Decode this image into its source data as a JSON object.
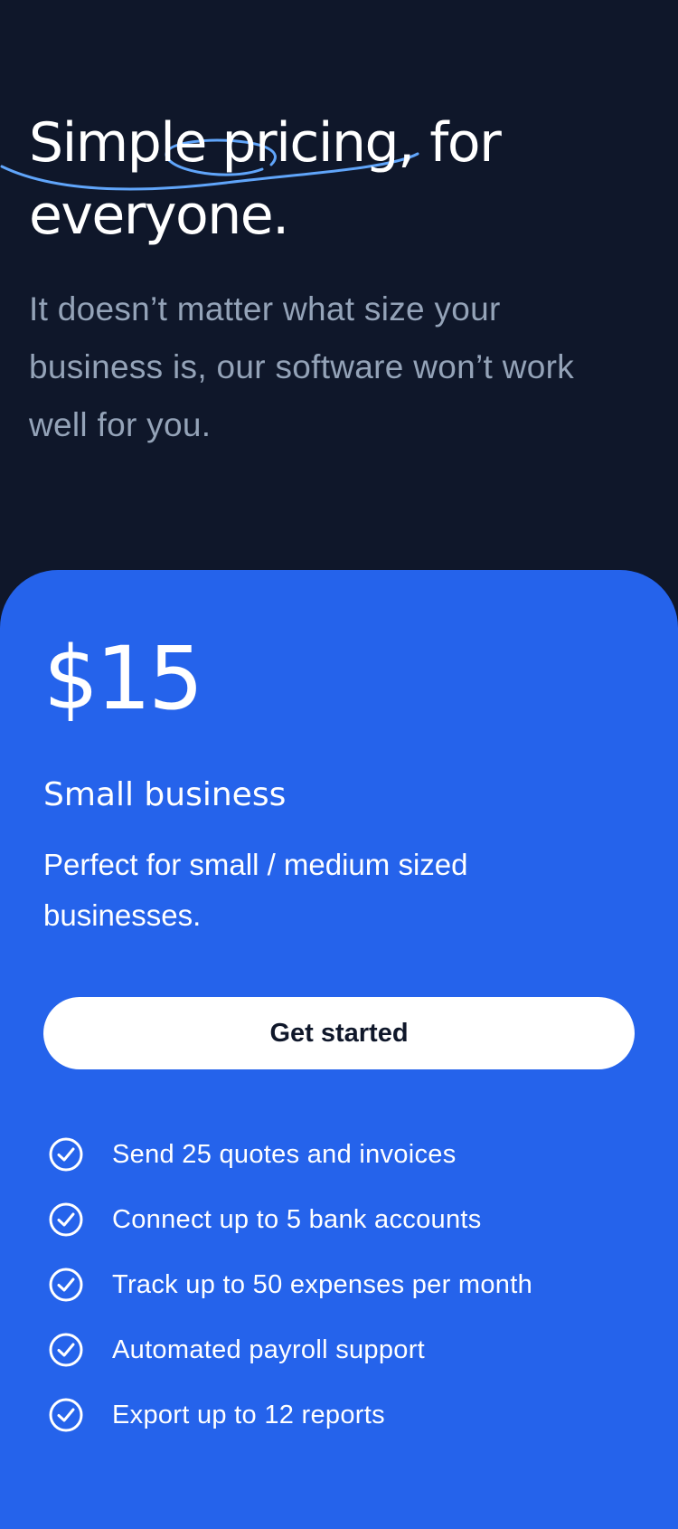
{
  "hero": {
    "title_highlight": "Simple pricing",
    "title_rest": ", for everyone.",
    "subtitle": "It doesn’t matter what size your business is, our software won’t work well for you.",
    "accent_color": "#60a5fa",
    "background_color": "#0f172a"
  },
  "plan": {
    "price": "$15",
    "name": "Small business",
    "description": "Perfect for small / medium sized businesses.",
    "cta_label": "Get started",
    "card_color": "#2563eb",
    "feature_icon": "check-circle-icon",
    "features": [
      "Send 25 quotes and invoices",
      "Connect up to 5 bank accounts",
      "Track up to 50 expenses per month",
      "Automated payroll support",
      "Export up to 12 reports"
    ]
  }
}
